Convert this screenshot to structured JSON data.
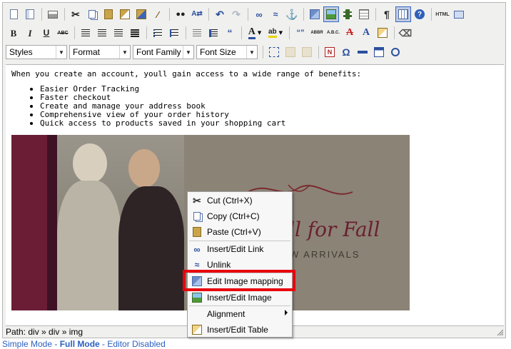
{
  "toolbar": {
    "row1": [
      "new-document",
      "template",
      "print",
      "cut",
      "copy",
      "paste",
      "paste-text",
      "paste-word",
      "cleanup",
      "find",
      "replace",
      "undo",
      "redo",
      "link",
      "unlink",
      "anchor",
      "image-map",
      "insert-image",
      "media",
      "table",
      "show-blocks",
      "visual-aid",
      "help",
      "html-source",
      "full-screen"
    ],
    "row2": {
      "bold": "B",
      "italic": "I",
      "underline": "U",
      "strike": "ABC",
      "abbr": "ABBR",
      "acronym": "A.B.C.",
      "font_color": "A",
      "bg_color": "ab"
    },
    "row3": {
      "styles": "Styles",
      "format": "Format",
      "font_family": "Font Family",
      "font_size": "Font Size",
      "omega": "Ω"
    }
  },
  "content": {
    "intro": "When you create an account, youll gain access to a wide range of benefits:",
    "bullets": [
      "Easier Order Tracking",
      "Faster checkout",
      "Create and manage your address book",
      "Comprehensive view of your order history",
      "Quick access to products saved in your shopping cart"
    ],
    "image": {
      "headline": "ll for Fall",
      "tagline": "W ARRIVALS"
    }
  },
  "context_menu": {
    "items": [
      {
        "label": "Cut (Ctrl+X)",
        "icon": "scissors-icon"
      },
      {
        "label": "Copy (Ctrl+C)",
        "icon": "copy-icon"
      },
      {
        "label": "Paste (Ctrl+V)",
        "icon": "paste-icon"
      },
      {
        "label": "Insert/Edit Link",
        "icon": "link-icon"
      },
      {
        "label": "Unlink",
        "icon": "unlink-icon"
      },
      {
        "label": "Edit Image mapping",
        "icon": "image-map-icon"
      },
      {
        "label": "Insert/Edit Image",
        "icon": "image-icon"
      },
      {
        "label": "Alignment",
        "icon": "none"
      },
      {
        "label": "Insert/Edit Table",
        "icon": "table-icon"
      }
    ]
  },
  "status": {
    "path": "Path: div » div » img"
  },
  "modes": {
    "simple": "Simple Mode",
    "full": "Full Mode",
    "disabled": "Editor Disabled"
  },
  "colors": {
    "highlight": "#e8000b",
    "toolbar_bg": "#f0f0ee",
    "link_blue": "#2b5fc0"
  }
}
